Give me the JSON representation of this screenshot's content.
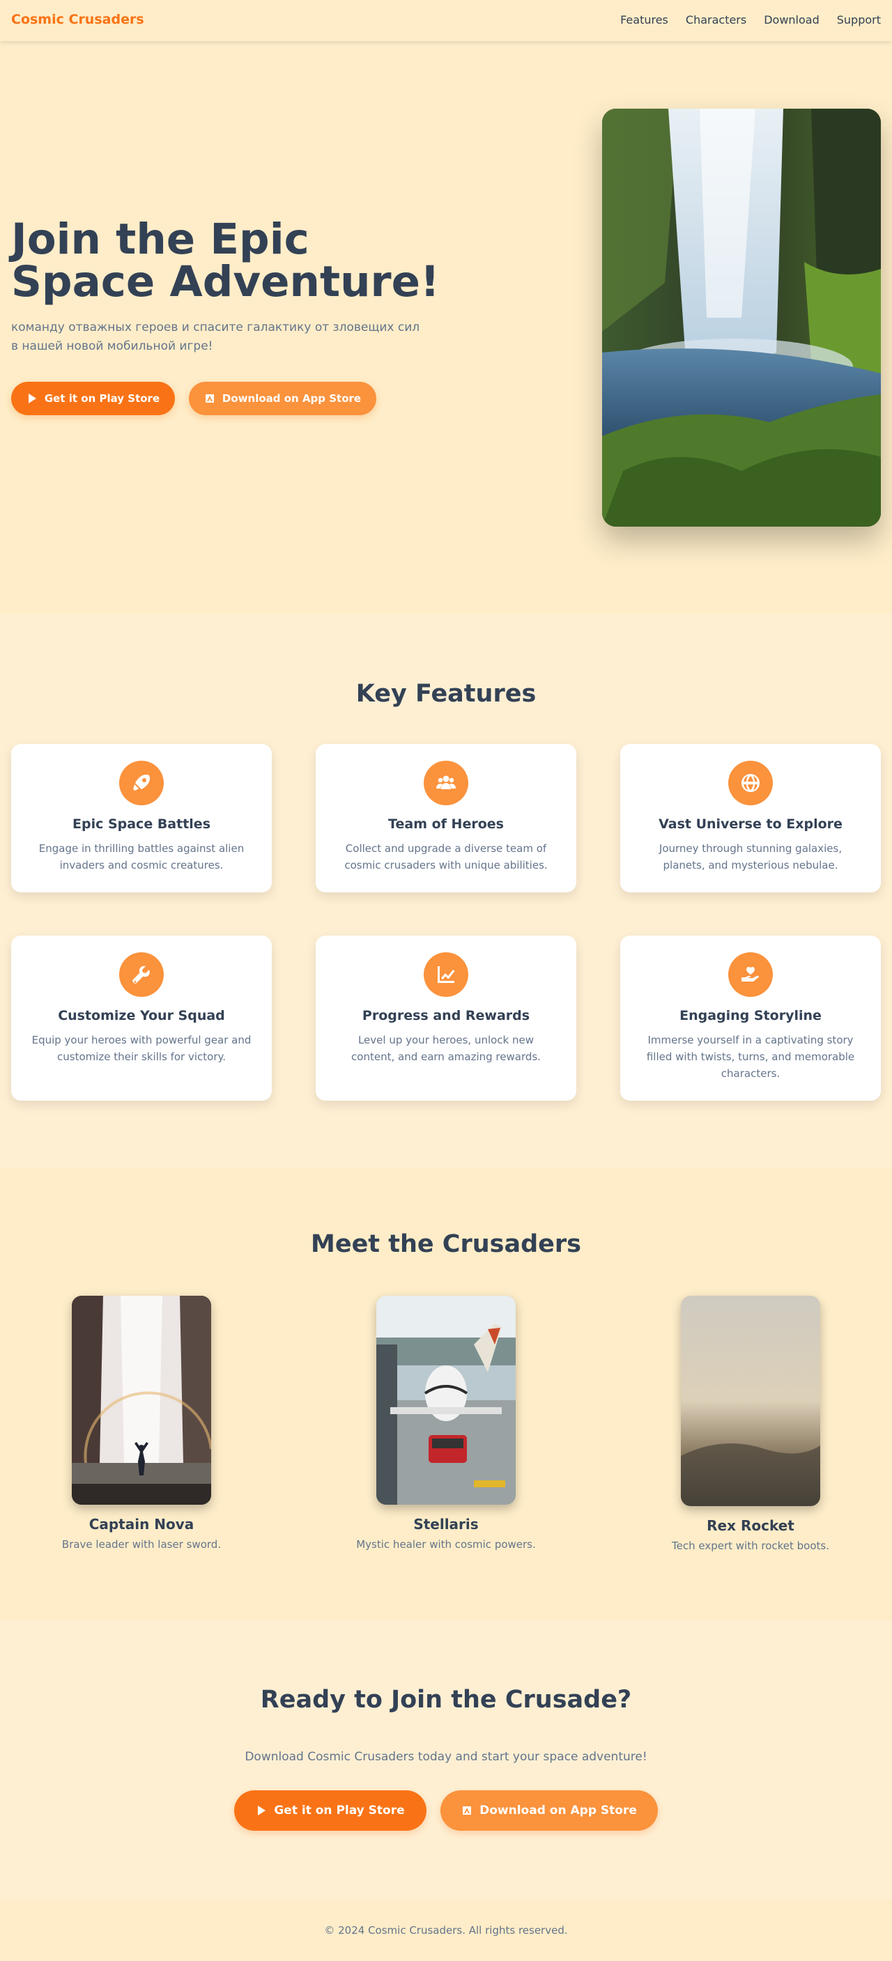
{
  "nav": {
    "brand": "Cosmic Crusaders",
    "links": [
      "Features",
      "Characters",
      "Download",
      "Support"
    ]
  },
  "hero": {
    "title": "Join the Epic Space Adventure!",
    "subtitle": "команду отважных героев и спасите галактику от зловещих сил в нашей новой мобильной игре!",
    "play_store_label": "Get it on Play Store",
    "app_store_label": "Download on App Store"
  },
  "features": {
    "title": "Key Features",
    "items": [
      {
        "icon": "rocket-icon",
        "title": "Epic Space Battles",
        "desc": "Engage in thrilling battles against alien invaders and cosmic creatures."
      },
      {
        "icon": "users-icon",
        "title": "Team of Heroes",
        "desc": "Collect and upgrade a diverse team of cosmic crusaders with unique abilities."
      },
      {
        "icon": "globe-icon",
        "title": "Vast Universe to Explore",
        "desc": "Journey through stunning galaxies, planets, and mysterious nebulae."
      },
      {
        "icon": "wrench-icon",
        "title": "Customize Your Squad",
        "desc": "Equip your heroes with powerful gear and customize their skills for victory."
      },
      {
        "icon": "chart-line-icon",
        "title": "Progress and Rewards",
        "desc": "Level up your heroes, unlock new content, and earn amazing rewards."
      },
      {
        "icon": "hand-heart-icon",
        "title": "Engaging Storyline",
        "desc": "Immerse yourself in a captivating story filled with twists, turns, and memorable characters."
      }
    ]
  },
  "crusaders": {
    "title": "Meet the Crusaders",
    "items": [
      {
        "name": "Captain Nova",
        "desc": "Brave leader with laser sword."
      },
      {
        "name": "Stellaris",
        "desc": "Mystic healer with cosmic powers."
      },
      {
        "name": "Rex Rocket",
        "desc": "Tech expert with rocket boots."
      }
    ]
  },
  "cta": {
    "title": "Ready to Join the Crusade?",
    "subtitle": "Download Cosmic Crusaders today and start your space adventure!",
    "play_store_label": "Get it on Play Store",
    "app_store_label": "Download on App Store"
  },
  "footer": {
    "text": "© 2024 Cosmic Crusaders. All rights reserved."
  },
  "colors": {
    "accent": "#f97316",
    "accent_light": "#fb923c",
    "heading": "#334155",
    "muted": "#64748b",
    "background": "#feedc8"
  }
}
